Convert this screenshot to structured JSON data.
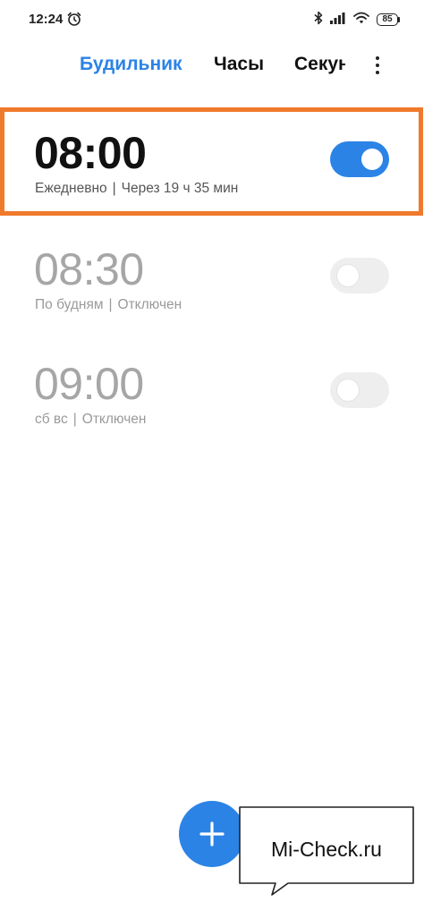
{
  "status_bar": {
    "time": "12:24",
    "battery": "85",
    "icons": [
      "alarm-clock-icon",
      "bluetooth-icon",
      "signal-icon",
      "wifi-icon",
      "battery-icon"
    ]
  },
  "tabs": [
    {
      "label": "Будильник",
      "active": true
    },
    {
      "label": "Часы",
      "active": false
    },
    {
      "label": "Секундомер",
      "active": false
    }
  ],
  "alarms": [
    {
      "time": "08:00",
      "repeat": "Ежедневно",
      "separator": "|",
      "status": "Через 19 ч 35 мин",
      "enabled": true
    },
    {
      "time": "08:30",
      "repeat": "По будням",
      "separator": "|",
      "status": "Отключен",
      "enabled": false
    },
    {
      "time": "09:00",
      "repeat": "сб вс",
      "separator": "|",
      "status": "Отключен",
      "enabled": false
    }
  ],
  "fab": {
    "icon": "plus-icon"
  },
  "watermark": {
    "text": "Mi-Check.ru"
  },
  "colors": {
    "accent": "#2b83e6",
    "highlight_border": "#ef7a2c",
    "toggle_off": "#eeeeee",
    "disabled_text": "#a6a6a6"
  }
}
